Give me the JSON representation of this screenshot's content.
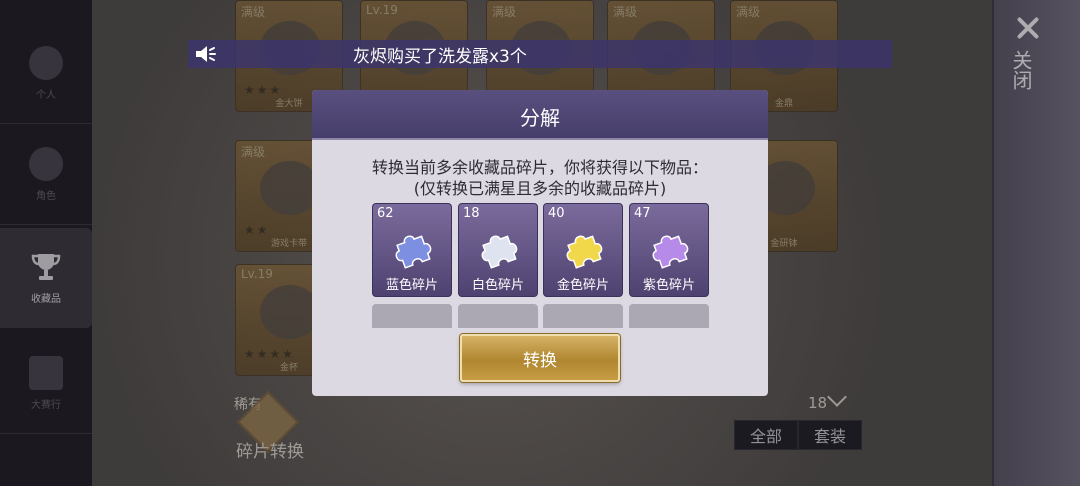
{
  "sidebar": {
    "items": [
      {
        "label": "个人"
      },
      {
        "label": "角色"
      },
      {
        "label": "收藏品"
      },
      {
        "label": "大赛行"
      }
    ]
  },
  "cards": [
    {
      "lv": "满级",
      "name": "金大饼"
    },
    {
      "lv": "Lv.19",
      "name": ""
    },
    {
      "lv": "满级",
      "name": ""
    },
    {
      "lv": "满级",
      "name": ""
    },
    {
      "lv": "满级",
      "name": "金鼎"
    },
    {
      "lv": "满级",
      "name": "游戏卡带"
    },
    {
      "lv": "",
      "name": "金研钵"
    },
    {
      "lv": "Lv.19",
      "name": "金杯"
    }
  ],
  "bottom": {
    "rarity": "稀有",
    "fragment_convert": "碎片转换",
    "count": "18",
    "filter_all": "全部",
    "filter_set": "套装"
  },
  "announce": {
    "text": "灰烬购买了洗发露x3个"
  },
  "close_panel": {
    "label": "关闭"
  },
  "modal": {
    "title": "分解",
    "desc_line1": "转换当前多余收藏品碎片，你将获得以下物品：",
    "desc_line2": "(仅转换已满星且多余的收藏品碎片)",
    "fragments": [
      {
        "qty": "62",
        "name": "蓝色碎片",
        "color": "#7d8fe0"
      },
      {
        "qty": "18",
        "name": "白色碎片",
        "color": "#dfe3f0"
      },
      {
        "qty": "40",
        "name": "金色碎片",
        "color": "#f0d84a"
      },
      {
        "qty": "47",
        "name": "紫色碎片",
        "color": "#b58ae8"
      }
    ],
    "convert_button": "转换"
  }
}
